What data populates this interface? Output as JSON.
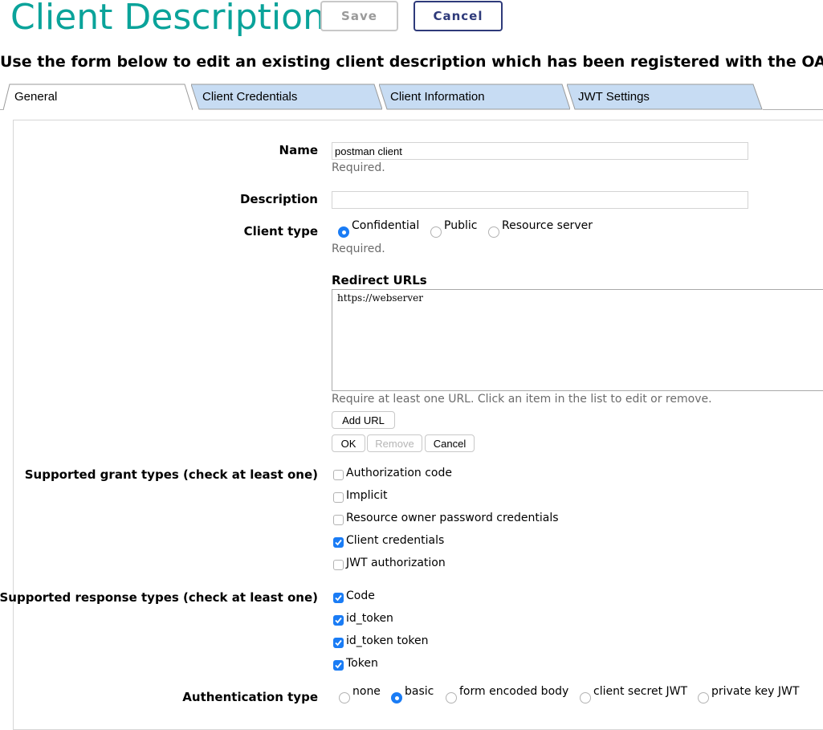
{
  "header": {
    "title": "Client Description",
    "save_label": "Save",
    "cancel_label": "Cancel"
  },
  "intro": "Use the form below to edit an existing client description which has been registered with the OA",
  "tabs": [
    {
      "label": "General",
      "active": true
    },
    {
      "label": "Client Credentials",
      "active": false
    },
    {
      "label": "Client Information",
      "active": false
    },
    {
      "label": "JWT Settings",
      "active": false
    }
  ],
  "form": {
    "name": {
      "label": "Name",
      "value": "postman client",
      "hint": "Required."
    },
    "description": {
      "label": "Description",
      "value": ""
    },
    "client_type": {
      "label": "Client type",
      "options": [
        {
          "label": "Confidential",
          "selected": true
        },
        {
          "label": "Public",
          "selected": false
        },
        {
          "label": "Resource server",
          "selected": false
        }
      ],
      "hint": "Required."
    },
    "redirect_urls": {
      "label": "Redirect URLs",
      "items": [
        "https://webserver"
      ],
      "hint": "Require at least one URL. Click an item in the list to edit or remove.",
      "add_label": "Add URL",
      "ok_label": "OK",
      "remove_label": "Remove",
      "cancel_label": "Cancel"
    },
    "grant_types": {
      "label": "Supported grant types (check at least one)",
      "options": [
        {
          "label": "Authorization code",
          "checked": false
        },
        {
          "label": "Implicit",
          "checked": false
        },
        {
          "label": "Resource owner password credentials",
          "checked": false
        },
        {
          "label": "Client credentials",
          "checked": true
        },
        {
          "label": "JWT authorization",
          "checked": false
        }
      ]
    },
    "response_types": {
      "label": "Supported response types (check at least one)",
      "options": [
        {
          "label": "Code",
          "checked": true
        },
        {
          "label": "id_token",
          "checked": true
        },
        {
          "label": "id_token token",
          "checked": true
        },
        {
          "label": "Token",
          "checked": true
        }
      ]
    },
    "auth_type": {
      "label": "Authentication type",
      "options": [
        {
          "label": "none",
          "selected": false
        },
        {
          "label": "basic",
          "selected": true
        },
        {
          "label": "form encoded body",
          "selected": false
        },
        {
          "label": "client secret JWT",
          "selected": false
        },
        {
          "label": "private key JWT",
          "selected": false
        }
      ]
    }
  },
  "colors": {
    "title": "#0aa39a",
    "tab_inactive": "#c7dcf3",
    "accent": "#1a7cf5",
    "cancel_border": "#2e3a7a"
  }
}
